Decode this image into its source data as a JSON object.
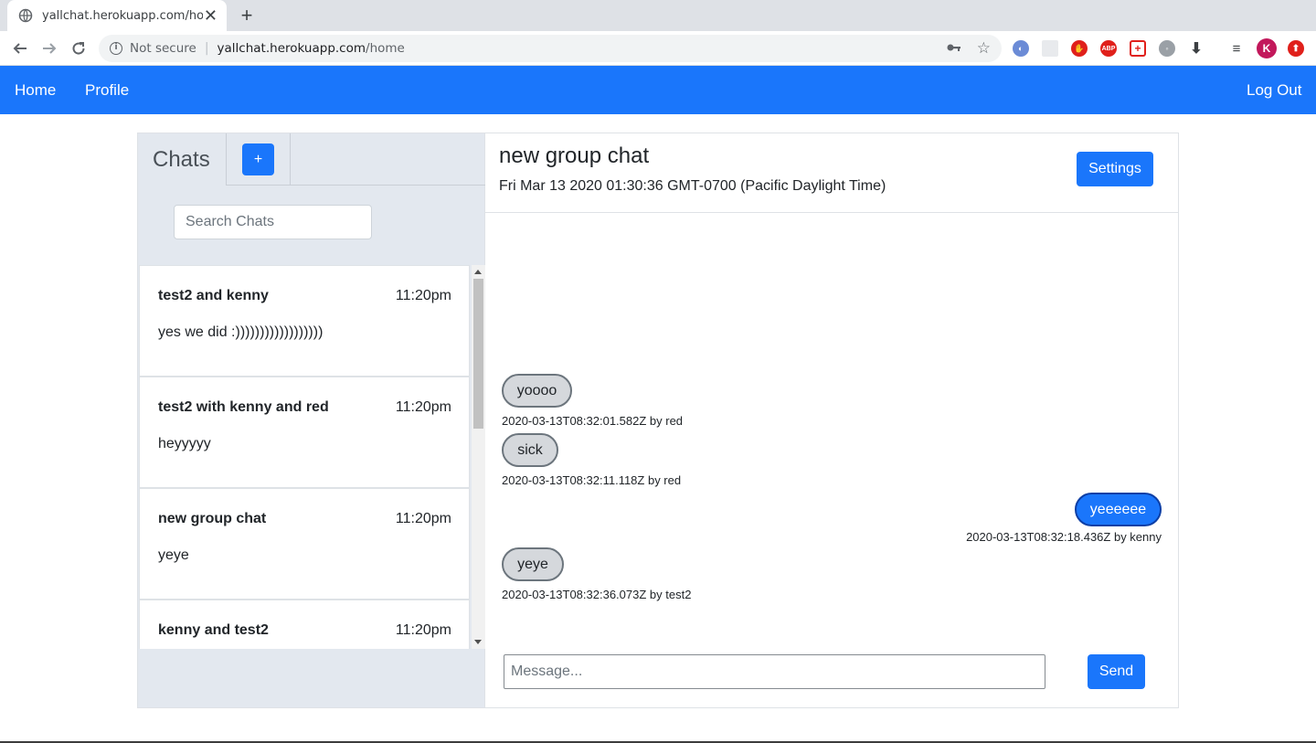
{
  "browser": {
    "tab_title": "yallchat.herokuapp.com/home",
    "new_tab": "+",
    "close": "✕",
    "not_secure": "Not secure",
    "url_host": "yallchat.herokuapp.com",
    "url_path": "/home",
    "profile_initial": "K"
  },
  "navbar": {
    "color": "#1a76fb",
    "home": "Home",
    "profile": "Profile",
    "logout": "Log Out"
  },
  "sidebar": {
    "title": "Chats",
    "add_label": "+",
    "search_placeholder": "Search Chats",
    "chats": [
      {
        "name": "test2 and kenny",
        "time": "11:20pm",
        "preview": "yes we did :))))))))))))))))))"
      },
      {
        "name": "test2 with kenny and red",
        "time": "11:20pm",
        "preview": "heyyyyy"
      },
      {
        "name": "new group chat",
        "time": "11:20pm",
        "preview": "yeye"
      },
      {
        "name": "kenny and test2",
        "time": "11:20pm",
        "preview": ""
      }
    ]
  },
  "chat": {
    "title": "new group chat",
    "date": "Fri Mar 13 2020 01:30:36 GMT-0700 (Pacific Daylight Time)",
    "settings_label": "Settings",
    "messages": [
      {
        "text": "yoooo",
        "meta": "2020-03-13T08:32:01.582Z by red",
        "mine": false
      },
      {
        "text": "sick",
        "meta": "2020-03-13T08:32:11.118Z by red",
        "mine": false
      },
      {
        "text": "yeeeeee",
        "meta": "2020-03-13T08:32:18.436Z by kenny",
        "mine": true
      },
      {
        "text": "yeye",
        "meta": "2020-03-13T08:32:36.073Z by test2",
        "mine": false
      }
    ],
    "input_placeholder": "Message...",
    "send_label": "Send"
  }
}
